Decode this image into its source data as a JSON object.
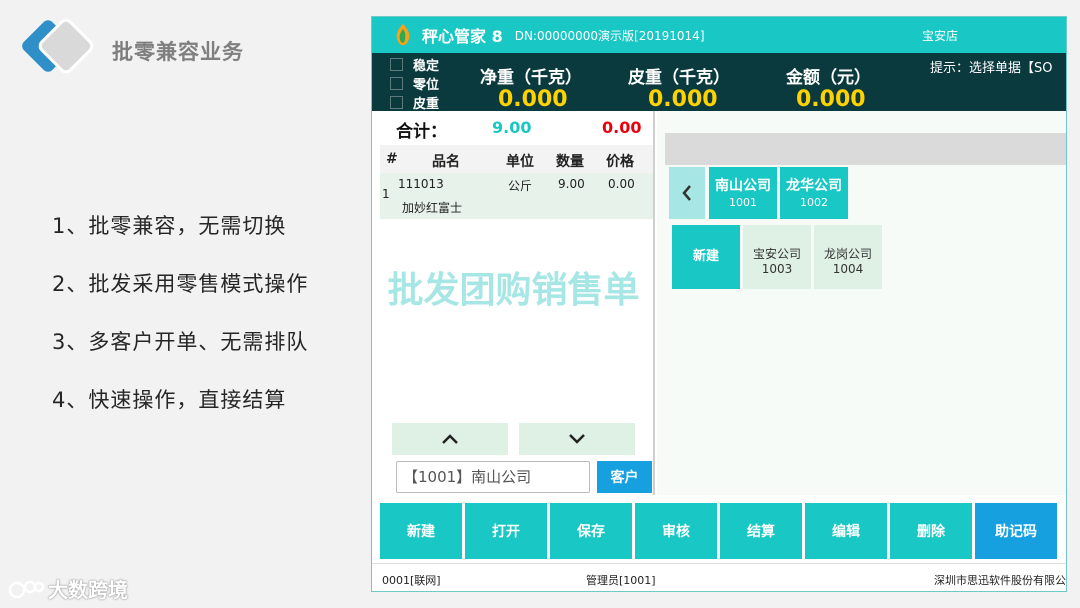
{
  "slide": {
    "title": "批零兼容业务",
    "bullets": [
      "1、批零兼容，无需切换",
      "2、批发采用零售模式操作",
      "3、多客户开单、无需排队",
      "4、快速操作，直接结算"
    ],
    "watermark": "大数跨境"
  },
  "app": {
    "name": "秤心管家 8",
    "dn": "DN:00000000演示版[20191014]",
    "store": "宝安店",
    "checkboxes": [
      "稳定",
      "零位",
      "皮重"
    ],
    "net_weight": {
      "label": "净重（千克）",
      "value": "0.000"
    },
    "tare": {
      "label": "皮重（千克）",
      "value": "0.000"
    },
    "amount": {
      "label": "金额（元）",
      "value": "0.000"
    },
    "hint": "提示：选择单据【SO",
    "colors": {
      "accent": "#19c7c5",
      "dark": "#0b3a3e",
      "yellow": "#ffd200",
      "blue": "#17a0e0",
      "red": "#e8000e"
    }
  },
  "order": {
    "total_label": "合计：",
    "total_qty": "9.00",
    "total_amount": "0.00",
    "columns": [
      "#",
      "品名",
      "单位",
      "数量",
      "价格"
    ],
    "rows": [
      {
        "no": "1",
        "code": "111013",
        "name": "加妙红富士",
        "unit": "公斤",
        "qty": "9.00",
        "price": "0.00"
      }
    ],
    "watermark": "批发团购销售单",
    "customer_value": "【1001】南山公司",
    "customer_button": "客户"
  },
  "customers": {
    "tabs": [
      {
        "name": "南山公司",
        "code": "1001"
      },
      {
        "name": "龙华公司",
        "code": "1002"
      }
    ],
    "new_label": "新建",
    "tiles": [
      {
        "name": "宝安公司",
        "code": "1003"
      },
      {
        "name": "龙岗公司",
        "code": "1004"
      }
    ]
  },
  "toolbar": [
    "新建",
    "打开",
    "保存",
    "审核",
    "结算",
    "编辑",
    "删除",
    "助记码"
  ],
  "status": {
    "left": "0001[联网]",
    "middle": "管理员[1001]",
    "right": "深圳市思迅软件股份有限公"
  }
}
